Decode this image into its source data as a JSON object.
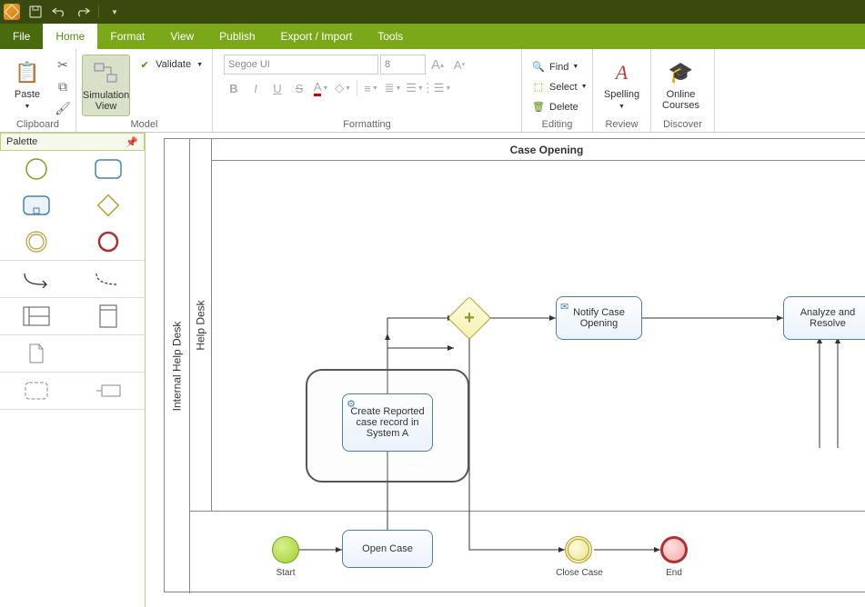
{
  "titlebar": {
    "icons": [
      "save",
      "undo",
      "redo"
    ]
  },
  "menu": {
    "file": "File",
    "home": "Home",
    "format": "Format",
    "view": "View",
    "publish": "Publish",
    "export": "Export / Import",
    "tools": "Tools"
  },
  "ribbon": {
    "clipboard": {
      "paste": "Paste",
      "label": "Clipboard"
    },
    "model": {
      "simview": "Simulation\nView",
      "validate": "Validate",
      "label": "Model"
    },
    "formatting": {
      "font": "Segoe UI",
      "size": "8",
      "label": "Formatting"
    },
    "editing": {
      "find": "Find",
      "select": "Select",
      "delete": "Delete",
      "label": "Editing"
    },
    "review": {
      "spelling": "Spelling",
      "label": "Review"
    },
    "discover": {
      "courses": "Online\nCourses",
      "label": "Discover"
    }
  },
  "palette": {
    "title": "Palette"
  },
  "diagram": {
    "pool": "Internal Help Desk",
    "lane": "Help Desk",
    "lane_title": "Case Opening",
    "start": "Start",
    "open_case": "Open Case",
    "create": "Create Reported case record in System A",
    "notify": "Notify Case Opening",
    "analyze": "Analyze and Resolve",
    "close": "Close Case",
    "end": "End"
  },
  "chart_data": {
    "type": "bpmn",
    "pool": "Internal Help Desk",
    "lanes": [
      "Help Desk"
    ],
    "phase": "Case Opening",
    "nodes": [
      {
        "id": "start",
        "type": "startEvent",
        "label": "Start"
      },
      {
        "id": "open",
        "type": "task",
        "label": "Open Case"
      },
      {
        "id": "create",
        "type": "serviceTask",
        "label": "Create Reported case record in System A",
        "subprocess": true
      },
      {
        "id": "gw",
        "type": "parallelGateway"
      },
      {
        "id": "notify",
        "type": "sendTask",
        "label": "Notify Case Opening"
      },
      {
        "id": "analyze",
        "type": "task",
        "label": "Analyze and Resolve"
      },
      {
        "id": "close",
        "type": "intermediateEvent",
        "label": "Close Case"
      },
      {
        "id": "end",
        "type": "endEvent",
        "label": "End"
      }
    ],
    "flows": [
      [
        "start",
        "open"
      ],
      [
        "open",
        "create"
      ],
      [
        "create",
        "gw"
      ],
      [
        "gw",
        "notify"
      ],
      [
        "gw",
        "analyze"
      ],
      [
        "gw",
        "close"
      ],
      [
        "close",
        "end"
      ],
      [
        "notify",
        "analyze"
      ]
    ]
  }
}
